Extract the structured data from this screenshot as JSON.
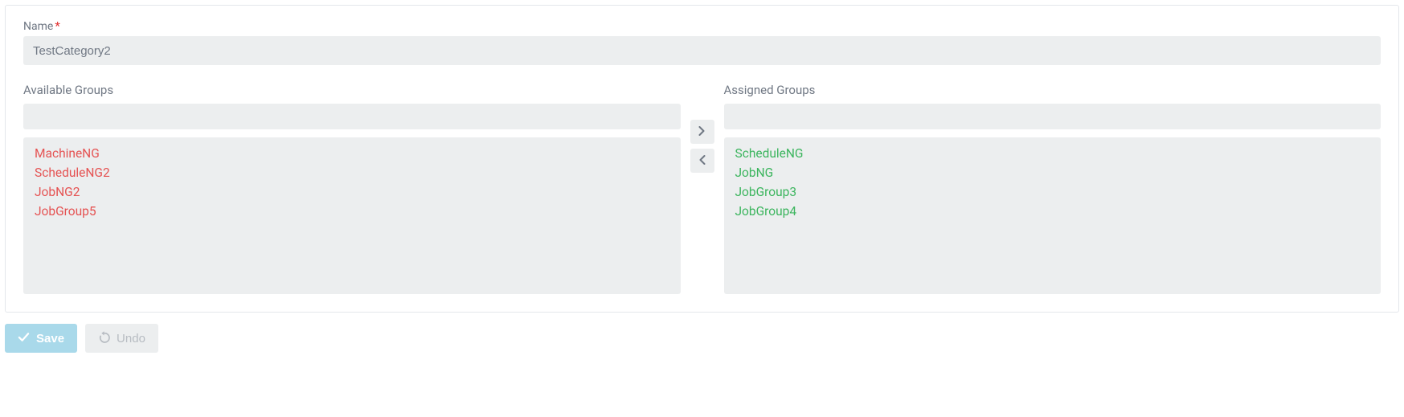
{
  "name_field": {
    "label": "Name",
    "value": "TestCategory2"
  },
  "available": {
    "label": "Available Groups",
    "filter_value": "",
    "items": [
      "MachineNG",
      "ScheduleNG2",
      "JobNG2",
      "JobGroup5"
    ]
  },
  "assigned": {
    "label": "Assigned Groups",
    "filter_value": "",
    "items": [
      "ScheduleNG",
      "JobNG",
      "JobGroup3",
      "JobGroup4"
    ]
  },
  "buttons": {
    "save": "Save",
    "undo": "Undo"
  }
}
